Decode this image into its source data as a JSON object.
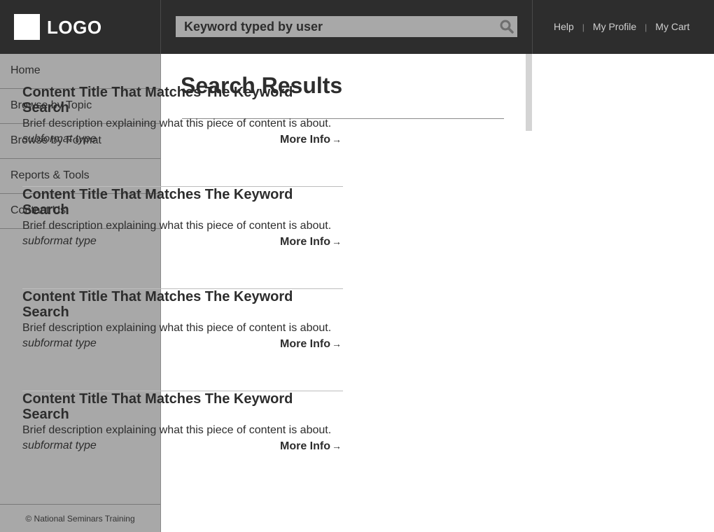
{
  "header": {
    "logo_text": "LOGO",
    "search": {
      "value": "Keyword typed by user",
      "icon": "search-icon"
    },
    "links": [
      {
        "label": "Help"
      },
      {
        "label": "My Profile"
      },
      {
        "label": "My Cart"
      }
    ],
    "separator": "|"
  },
  "sidebar": {
    "items": [
      {
        "label": "Home"
      },
      {
        "label": "Browse by Topic"
      },
      {
        "label": "Browse by Format"
      },
      {
        "label": "Reports & Tools"
      },
      {
        "label": "Contact Us"
      }
    ],
    "footer": "© National Seminars Training"
  },
  "main": {
    "title": "Search Results",
    "results": [
      {
        "title": "Content Title That Matches The Keyword Search",
        "description": "Brief description explaining what this piece of content is about.",
        "subformat": "subformat type",
        "more": "More Info",
        "arrow": "→"
      },
      {
        "title": "Content Title That Matches The Keyword Search",
        "description": "Brief description explaining what this piece of content is about.",
        "subformat": "subformat type",
        "more": "More Info",
        "arrow": "→"
      },
      {
        "title": "Content Title That Matches The Keyword Search",
        "description": "Brief description explaining what this piece of content is about.",
        "subformat": "subformat type",
        "more": "More Info",
        "arrow": "→"
      },
      {
        "title": "Content Title That Matches The Keyword Search",
        "description": "Brief description explaining what this piece of content is about.",
        "subformat": "subformat type",
        "more": "More Info",
        "arrow": "→"
      }
    ]
  },
  "colors": {
    "header_bg": "#2d2d2d",
    "sidebar_bg": "#a8a8a8",
    "search_bg": "#a8a8a8",
    "text": "#2d2d2d"
  }
}
